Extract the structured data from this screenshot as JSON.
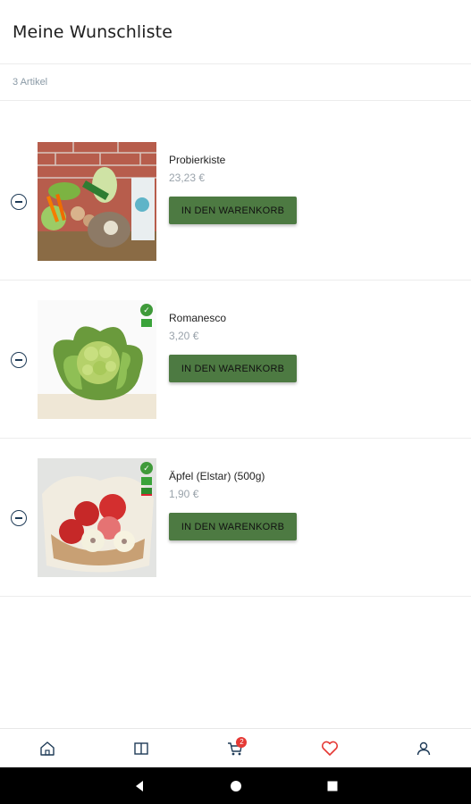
{
  "header": {
    "title": "Meine Wunschliste"
  },
  "summary": {
    "count_label": "3 Artikel"
  },
  "items": [
    {
      "name": "Probierkiste",
      "price": "23,23 €",
      "button_label": "IN DEN WARENKORB"
    },
    {
      "name": "Romanesco",
      "price": "3,20 €",
      "button_label": "IN DEN WARENKORB"
    },
    {
      "name": "Äpfel (Elstar) (500g)",
      "price": "1,90 €",
      "button_label": "IN DEN WARENKORB"
    }
  ],
  "bottom_nav": {
    "cart_badge": "2",
    "icons": [
      "home-icon",
      "catalog-icon",
      "cart-icon",
      "heart-icon",
      "user-icon"
    ],
    "active": "heart-icon"
  },
  "colors": {
    "accent_button": "#4d7a42",
    "active_nav": "#e53935",
    "icon": "#1f3b57"
  },
  "system_bar": {
    "icons": [
      "back-icon",
      "home-circle-icon",
      "recents-icon"
    ]
  }
}
